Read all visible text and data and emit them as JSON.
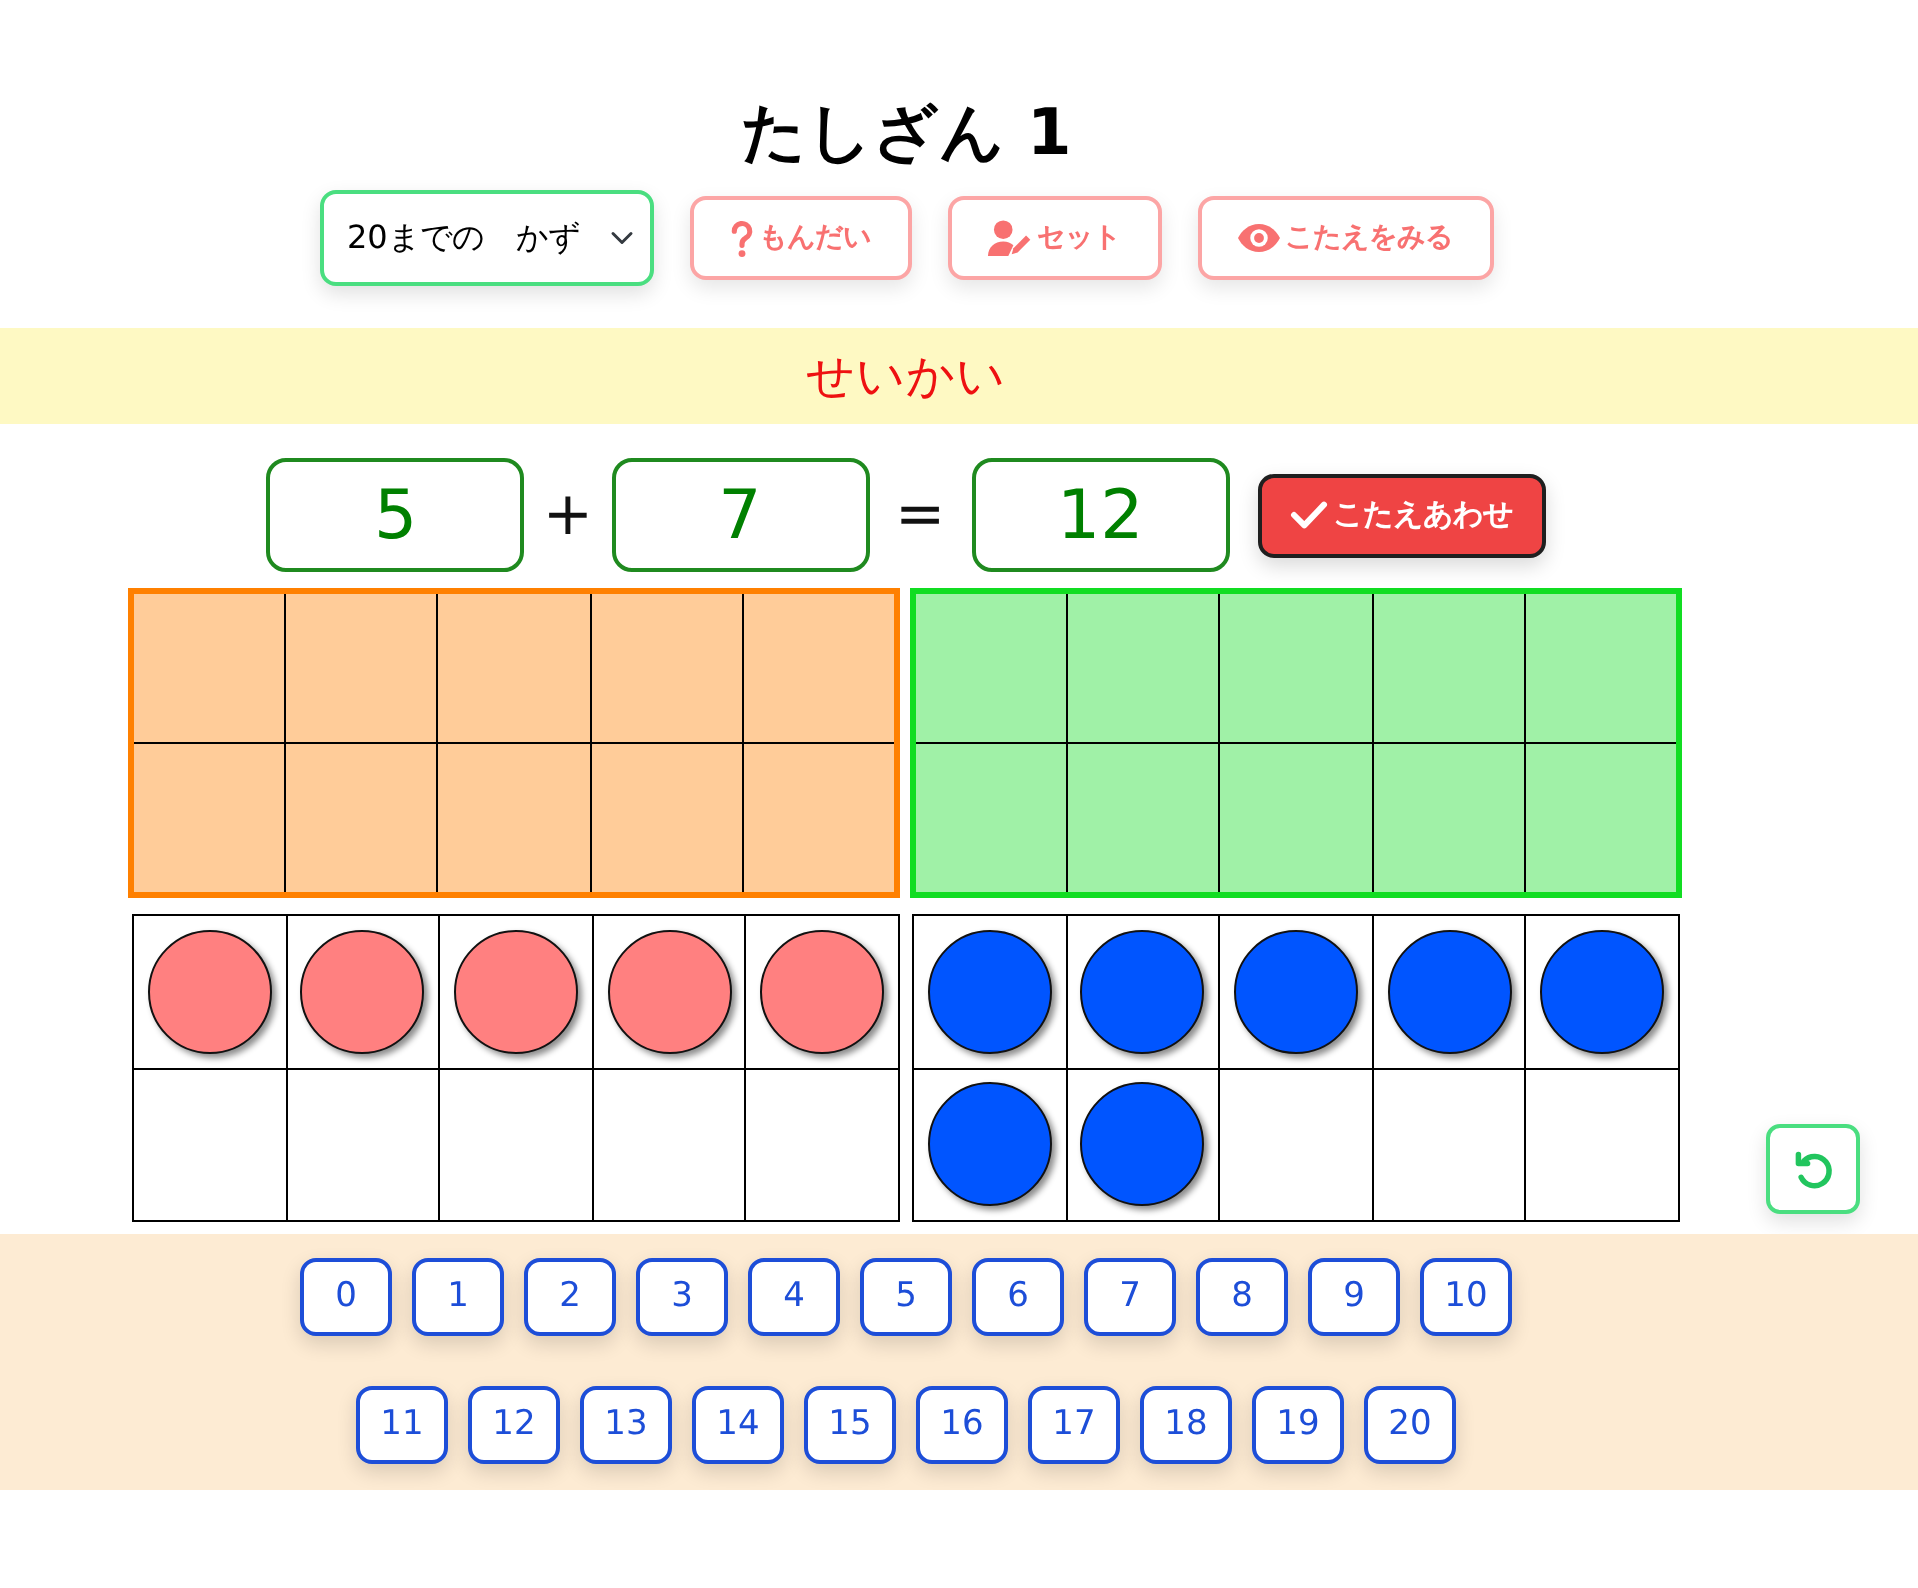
{
  "title": "たしざん 1",
  "range_select": {
    "value": "20までの　かず"
  },
  "toolbar_buttons": [
    {
      "kind": "question",
      "label": "もんだい"
    },
    {
      "kind": "user-pen",
      "label": "セット"
    },
    {
      "kind": "eye",
      "label": "こたえをみる"
    }
  ],
  "result": {
    "text": "せいかい"
  },
  "equation": {
    "addend_1": "5",
    "operator": "+",
    "addend_2": "7",
    "equals": "=",
    "answer": "12"
  },
  "check_button": {
    "label": "こたえあわせ"
  },
  "ten_frames": [
    {
      "color": "#ff8000"
    },
    {
      "color": "#11dd22"
    }
  ],
  "counter_frames": [
    {
      "color": "#ff8080",
      "cells": [
        {
          "filled": true
        },
        {
          "filled": true
        },
        {
          "filled": true
        },
        {
          "filled": true
        },
        {
          "filled": true
        },
        {
          "filled": false
        },
        {
          "filled": false
        },
        {
          "filled": false
        },
        {
          "filled": false
        },
        {
          "filled": false
        }
      ]
    },
    {
      "color": "#0055ff",
      "cells": [
        {
          "filled": true
        },
        {
          "filled": true
        },
        {
          "filled": true
        },
        {
          "filled": true
        },
        {
          "filled": true
        },
        {
          "filled": true
        },
        {
          "filled": true
        },
        {
          "filled": false
        },
        {
          "filled": false
        },
        {
          "filled": false
        }
      ]
    }
  ],
  "number_buttons": [
    [
      "0",
      "1",
      "2",
      "3",
      "4",
      "5",
      "6",
      "7",
      "8",
      "9",
      "10"
    ],
    [
      "11",
      "12",
      "13",
      "14",
      "15",
      "16",
      "17",
      "18",
      "19",
      "20"
    ]
  ]
}
